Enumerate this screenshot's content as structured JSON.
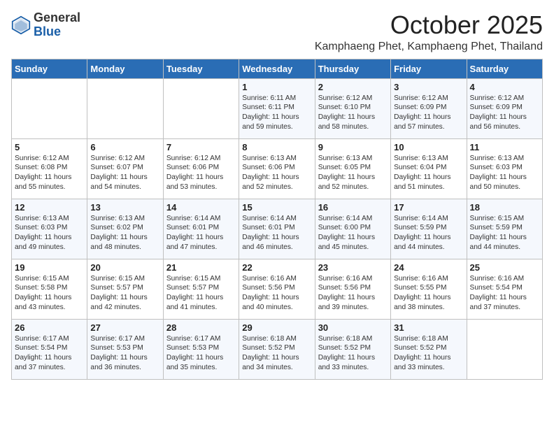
{
  "header": {
    "logo_general": "General",
    "logo_blue": "Blue",
    "month_title": "October 2025",
    "location": "Kamphaeng Phet, Kamphaeng Phet, Thailand"
  },
  "weekdays": [
    "Sunday",
    "Monday",
    "Tuesday",
    "Wednesday",
    "Thursday",
    "Friday",
    "Saturday"
  ],
  "weeks": [
    [
      {
        "day": "",
        "text": ""
      },
      {
        "day": "",
        "text": ""
      },
      {
        "day": "",
        "text": ""
      },
      {
        "day": "1",
        "text": "Sunrise: 6:11 AM\nSunset: 6:11 PM\nDaylight: 11 hours\nand 59 minutes."
      },
      {
        "day": "2",
        "text": "Sunrise: 6:12 AM\nSunset: 6:10 PM\nDaylight: 11 hours\nand 58 minutes."
      },
      {
        "day": "3",
        "text": "Sunrise: 6:12 AM\nSunset: 6:09 PM\nDaylight: 11 hours\nand 57 minutes."
      },
      {
        "day": "4",
        "text": "Sunrise: 6:12 AM\nSunset: 6:09 PM\nDaylight: 11 hours\nand 56 minutes."
      }
    ],
    [
      {
        "day": "5",
        "text": "Sunrise: 6:12 AM\nSunset: 6:08 PM\nDaylight: 11 hours\nand 55 minutes."
      },
      {
        "day": "6",
        "text": "Sunrise: 6:12 AM\nSunset: 6:07 PM\nDaylight: 11 hours\nand 54 minutes."
      },
      {
        "day": "7",
        "text": "Sunrise: 6:12 AM\nSunset: 6:06 PM\nDaylight: 11 hours\nand 53 minutes."
      },
      {
        "day": "8",
        "text": "Sunrise: 6:13 AM\nSunset: 6:06 PM\nDaylight: 11 hours\nand 52 minutes."
      },
      {
        "day": "9",
        "text": "Sunrise: 6:13 AM\nSunset: 6:05 PM\nDaylight: 11 hours\nand 52 minutes."
      },
      {
        "day": "10",
        "text": "Sunrise: 6:13 AM\nSunset: 6:04 PM\nDaylight: 11 hours\nand 51 minutes."
      },
      {
        "day": "11",
        "text": "Sunrise: 6:13 AM\nSunset: 6:03 PM\nDaylight: 11 hours\nand 50 minutes."
      }
    ],
    [
      {
        "day": "12",
        "text": "Sunrise: 6:13 AM\nSunset: 6:03 PM\nDaylight: 11 hours\nand 49 minutes."
      },
      {
        "day": "13",
        "text": "Sunrise: 6:13 AM\nSunset: 6:02 PM\nDaylight: 11 hours\nand 48 minutes."
      },
      {
        "day": "14",
        "text": "Sunrise: 6:14 AM\nSunset: 6:01 PM\nDaylight: 11 hours\nand 47 minutes."
      },
      {
        "day": "15",
        "text": "Sunrise: 6:14 AM\nSunset: 6:01 PM\nDaylight: 11 hours\nand 46 minutes."
      },
      {
        "day": "16",
        "text": "Sunrise: 6:14 AM\nSunset: 6:00 PM\nDaylight: 11 hours\nand 45 minutes."
      },
      {
        "day": "17",
        "text": "Sunrise: 6:14 AM\nSunset: 5:59 PM\nDaylight: 11 hours\nand 44 minutes."
      },
      {
        "day": "18",
        "text": "Sunrise: 6:15 AM\nSunset: 5:59 PM\nDaylight: 11 hours\nand 44 minutes."
      }
    ],
    [
      {
        "day": "19",
        "text": "Sunrise: 6:15 AM\nSunset: 5:58 PM\nDaylight: 11 hours\nand 43 minutes."
      },
      {
        "day": "20",
        "text": "Sunrise: 6:15 AM\nSunset: 5:57 PM\nDaylight: 11 hours\nand 42 minutes."
      },
      {
        "day": "21",
        "text": "Sunrise: 6:15 AM\nSunset: 5:57 PM\nDaylight: 11 hours\nand 41 minutes."
      },
      {
        "day": "22",
        "text": "Sunrise: 6:16 AM\nSunset: 5:56 PM\nDaylight: 11 hours\nand 40 minutes."
      },
      {
        "day": "23",
        "text": "Sunrise: 6:16 AM\nSunset: 5:56 PM\nDaylight: 11 hours\nand 39 minutes."
      },
      {
        "day": "24",
        "text": "Sunrise: 6:16 AM\nSunset: 5:55 PM\nDaylight: 11 hours\nand 38 minutes."
      },
      {
        "day": "25",
        "text": "Sunrise: 6:16 AM\nSunset: 5:54 PM\nDaylight: 11 hours\nand 37 minutes."
      }
    ],
    [
      {
        "day": "26",
        "text": "Sunrise: 6:17 AM\nSunset: 5:54 PM\nDaylight: 11 hours\nand 37 minutes."
      },
      {
        "day": "27",
        "text": "Sunrise: 6:17 AM\nSunset: 5:53 PM\nDaylight: 11 hours\nand 36 minutes."
      },
      {
        "day": "28",
        "text": "Sunrise: 6:17 AM\nSunset: 5:53 PM\nDaylight: 11 hours\nand 35 minutes."
      },
      {
        "day": "29",
        "text": "Sunrise: 6:18 AM\nSunset: 5:52 PM\nDaylight: 11 hours\nand 34 minutes."
      },
      {
        "day": "30",
        "text": "Sunrise: 6:18 AM\nSunset: 5:52 PM\nDaylight: 11 hours\nand 33 minutes."
      },
      {
        "day": "31",
        "text": "Sunrise: 6:18 AM\nSunset: 5:52 PM\nDaylight: 11 hours\nand 33 minutes."
      },
      {
        "day": "",
        "text": ""
      }
    ]
  ]
}
